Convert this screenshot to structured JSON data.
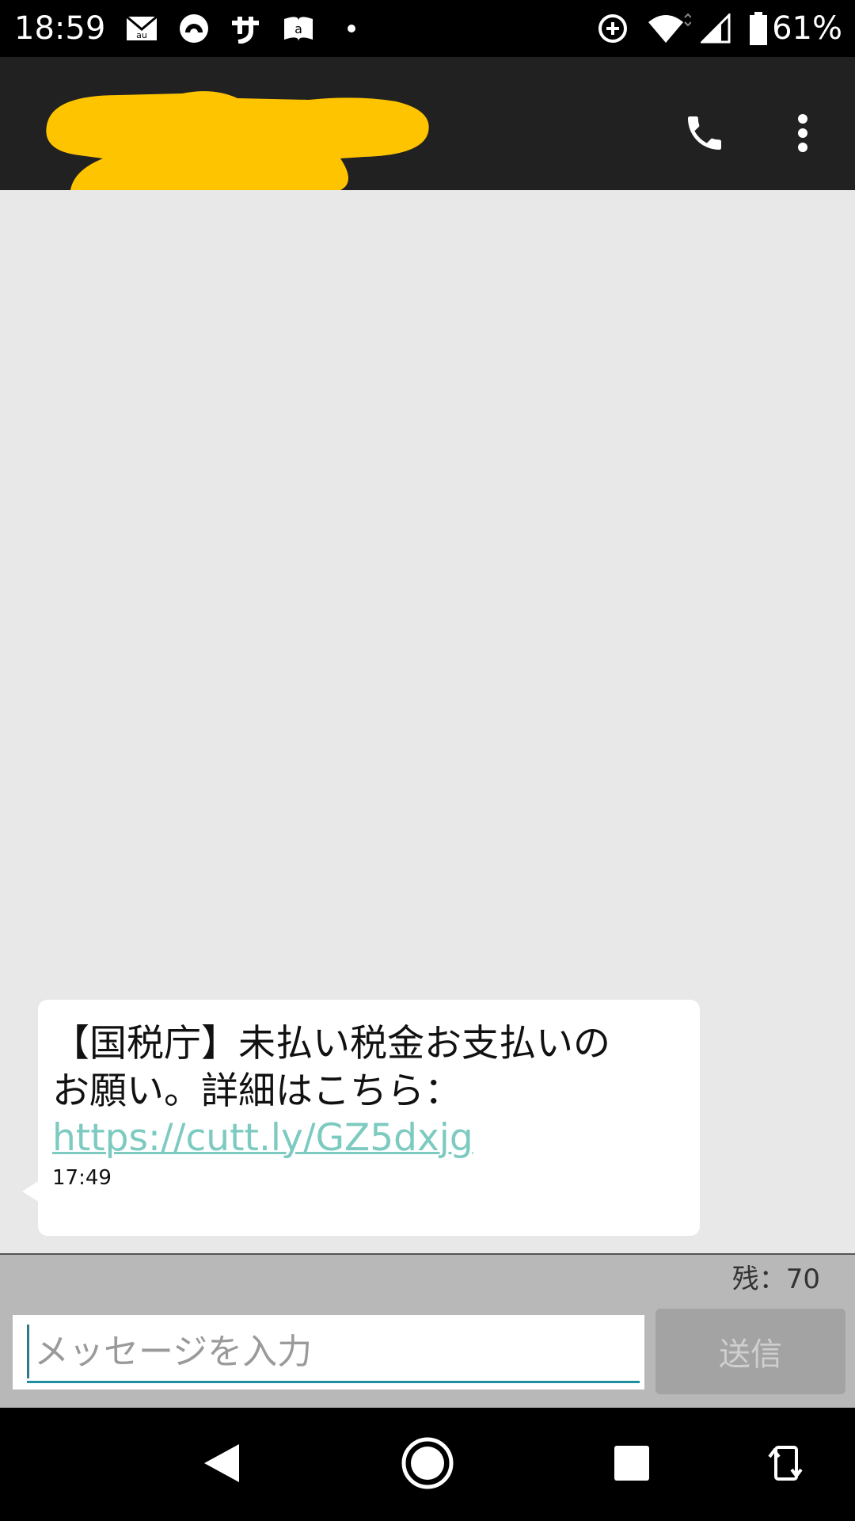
{
  "status_bar": {
    "time": "18:59",
    "battery_percent": "61%",
    "icons": [
      "mail-au-icon",
      "sync-icon",
      "sa-icon",
      "amazon-icon",
      "dot-icon",
      "data-saver-icon",
      "wifi-icon",
      "signal-icon",
      "battery-icon"
    ]
  },
  "app_bar": {
    "contact_name": "",
    "call_icon": "phone-icon",
    "menu_icon": "more-vert-icon",
    "redaction_color": "#ffc400"
  },
  "messages": [
    {
      "text": "【国税庁】未払い税金お支払いのお願い。詳細はこちら：",
      "link": "https://cutt.ly/GZ5dxjg",
      "time": "17:49"
    }
  ],
  "composer": {
    "remaining_label": "残：",
    "remaining_count": "70",
    "placeholder": "メッセージを入力",
    "send_label": "送信"
  },
  "nav_bar": {
    "icons": [
      "back-icon",
      "home-icon",
      "recents-icon",
      "rotate-icon"
    ]
  },
  "colors": {
    "link": "#7ccac0",
    "app_bar": "#212121",
    "background": "#e8e8e8"
  }
}
